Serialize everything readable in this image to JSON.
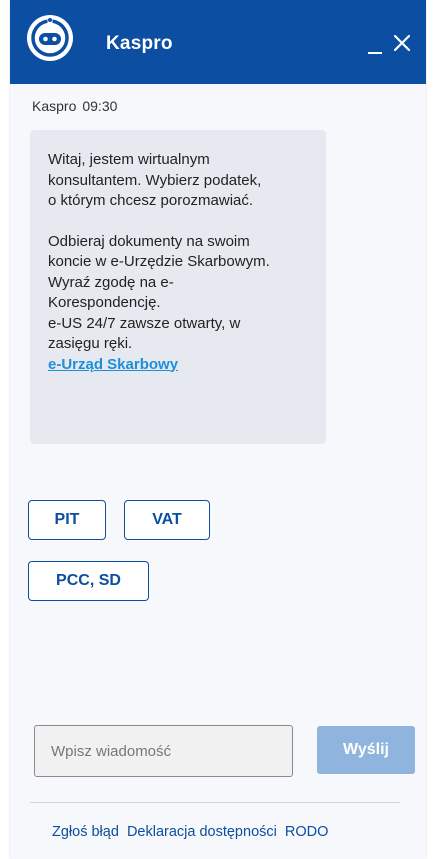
{
  "header": {
    "title": "Kaspro",
    "minimize_icon": "minimize-icon",
    "close_icon": "close-icon",
    "logo_icon": "kaspro-logo-icon",
    "background_color": "#0b4ea2"
  },
  "message": {
    "sender": "Kaspro",
    "time": "09:30",
    "paragraph1": "Witaj, jestem wirtualnym\nkonsultantem. Wybierz podatek,\no którym chcesz porozmawiać.",
    "paragraph2": "Odbieraj dokumenty na swoim\nkoncie w e-Urzędzie Skarbowym.\nWyraź zgodę na e-\nKorespondencję.\ne-US 24/7 zawsze otwarty, w\nzasięgu ręki.",
    "link_text": "e-Urząd Skarbowy"
  },
  "options": {
    "pit": "PIT",
    "vat": "VAT",
    "pcc_sd": "PCC, SD"
  },
  "composer": {
    "placeholder": "Wpisz wiadomość",
    "value": "",
    "send_label": "Wyślij",
    "send_color": "#8fb4dd"
  },
  "footer": {
    "report_error": "Zgłoś błąd",
    "accessibility": "Deklaracja dostępności",
    "rodo": "RODO"
  }
}
